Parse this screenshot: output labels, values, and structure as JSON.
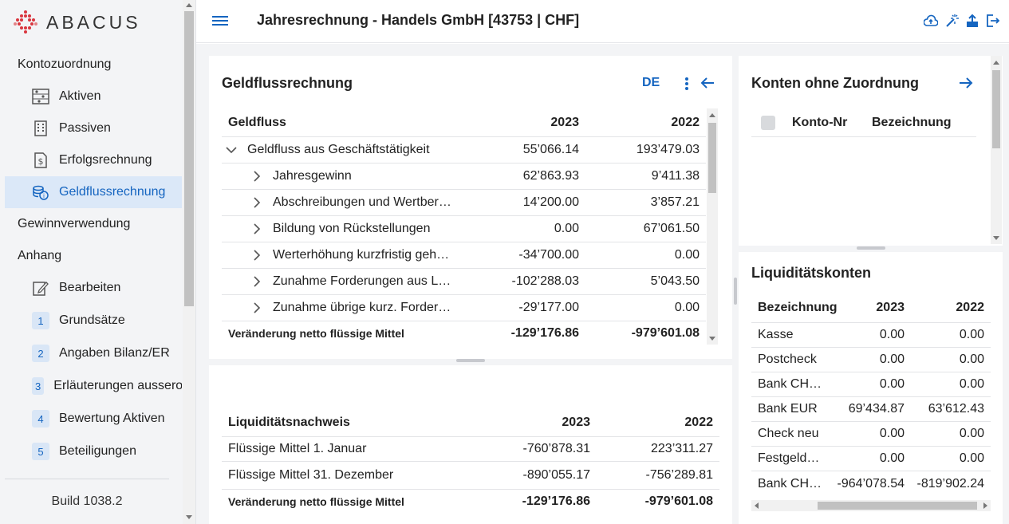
{
  "brand": {
    "name": "ABACUS"
  },
  "header": {
    "title": "Jahresrechnung - Handels GmbH [43753 | CHF]"
  },
  "sidebar": {
    "groups": [
      {
        "label": "Kontozuordnung"
      },
      {
        "label": "Gewinnverwendung"
      },
      {
        "label": "Anhang"
      }
    ],
    "items": [
      {
        "label": "Aktiven",
        "icon": "abacus-icon"
      },
      {
        "label": "Passiven",
        "icon": "building-icon"
      },
      {
        "label": "Erfolgsrechnung",
        "icon": "dollar-doc-icon"
      },
      {
        "label": "Geldflussrechnung",
        "icon": "coins-icon",
        "active": true
      },
      {
        "label": "Bearbeiten",
        "icon": "edit-icon"
      },
      {
        "label": "Grundsätze",
        "number": "1"
      },
      {
        "label": "Angaben Bilanz/ER",
        "number": "2"
      },
      {
        "label": "Erläuterungen ausserordentliche",
        "number": "3"
      },
      {
        "label": "Bewertung Aktiven",
        "number": "4"
      },
      {
        "label": "Beteiligungen",
        "number": "5"
      }
    ],
    "build": "Build 1038.2"
  },
  "geldfluss": {
    "title": "Geldflussrechnung",
    "lang": "DE",
    "columns": [
      "Geldfluss",
      "2023",
      "2022"
    ],
    "rows": [
      {
        "label": "Geldfluss aus Geschäftstätigkeit",
        "y2023": "55’066.14",
        "y2022": "193’479.03",
        "expanded": true
      },
      {
        "label": "Jahresgewinn",
        "y2023": "62’863.93",
        "y2022": "9’411.38"
      },
      {
        "label": "Abschreibungen und Wertberichtigungen",
        "y2023": "14’200.00",
        "y2022": "3’857.21"
      },
      {
        "label": "Bildung von Rückstellungen",
        "y2023": "0.00",
        "y2022": "67’061.50"
      },
      {
        "label": "Werterhöhung kurzfristig gehaltener Aktiven",
        "y2023": "-34’700.00",
        "y2022": "0.00"
      },
      {
        "label": "Zunahme Forderungen aus Lieferungen",
        "y2023": "-102’288.03",
        "y2022": "5’043.50"
      },
      {
        "label": "Zunahme übrige kurz. Forderungen",
        "y2023": "-29’177.00",
        "y2022": "0.00"
      }
    ],
    "footer": {
      "label": "Veränderung netto flüssige Mittel",
      "y2023": "-129’176.86",
      "y2022": "-979’601.08"
    }
  },
  "liquiditaetsnachweis": {
    "columns": [
      "Liquiditätsnachweis",
      "2023",
      "2022"
    ],
    "rows": [
      {
        "label": "Flüssige Mittel 1. Januar",
        "y2023": "-760’878.31",
        "y2022": "223’311.27"
      },
      {
        "label": "Flüssige Mittel 31. Dezember",
        "y2023": "-890’055.17",
        "y2022": "-756’289.81"
      }
    ],
    "footer": {
      "label": "Veränderung netto flüssige Mittel",
      "y2023": "-129’176.86",
      "y2022": "-979’601.08"
    }
  },
  "konten": {
    "title": "Konten ohne Zuordnung",
    "columns": [
      "Konto-Nr",
      "Bezeichnung"
    ]
  },
  "liquiditaetskonten": {
    "title": "Liquiditätskonten",
    "columns": [
      "Bezeichnung",
      "2023",
      "2022"
    ],
    "rows": [
      {
        "label": "Kasse",
        "y2023": "0.00",
        "y2022": "0.00"
      },
      {
        "label": "Postcheck",
        "y2023": "0.00",
        "y2022": "0.00"
      },
      {
        "label": "Bank CHF UBS",
        "y2023": "0.00",
        "y2022": "0.00"
      },
      {
        "label": "Bank EUR",
        "y2023": "69’434.87",
        "y2022": "63’612.43"
      },
      {
        "label": "Check neu",
        "y2023": "0.00",
        "y2022": "0.00"
      },
      {
        "label": "Festgeldanlagen",
        "y2023": "0.00",
        "y2022": "0.00"
      },
      {
        "label": "Bank CHF ZKB",
        "y2023": "-964’078.54",
        "y2022": "-819’902.24"
      }
    ]
  },
  "colors": {
    "accent": "#1565c0",
    "sidebar_bg": "#f3f4f6",
    "active_bg": "#dbe8f8",
    "logo": "#d9363e"
  }
}
